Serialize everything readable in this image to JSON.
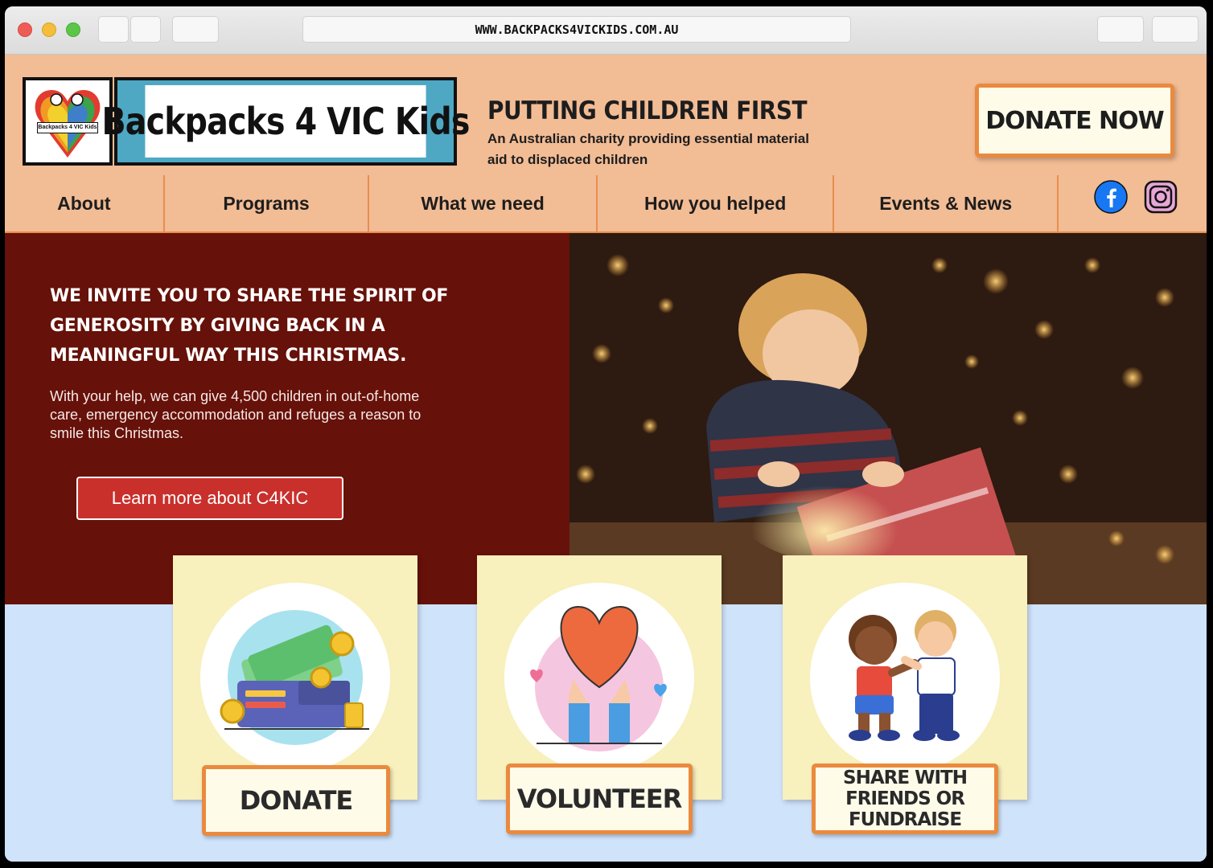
{
  "browser": {
    "url": "WWW.BACKPACKS4VICKIDS.COM.AU"
  },
  "header": {
    "logo_caption": "Backpacks 4 VIC Kids",
    "site_name": "Backpacks 4 VIC Kids",
    "tagline": "Putting Children First",
    "subtagline": "An Australian charity providing essential material aid to displaced children",
    "donate_now": "Donate Now"
  },
  "nav": {
    "items": [
      "About",
      "Programs",
      "What we need",
      "How you helped",
      "Events & News"
    ]
  },
  "social": {
    "facebook_icon": "facebook-icon",
    "instagram_icon": "instagram-icon"
  },
  "hero": {
    "heading": "We invite you to share the spirit of generosity by giving back in a meaningful way this Christmas.",
    "body": "With your help, we can give 4,500 children in out-of-home care, emergency accommodation and refuges a reason to smile this Christmas.",
    "button": "Learn more about C4KIC"
  },
  "cards": [
    {
      "label": "Donate",
      "icon": "wallet-icon"
    },
    {
      "label": "Volunteer",
      "icon": "heart-hands-icon"
    },
    {
      "label": "Share with friends or fundraise",
      "icon": "kids-friends-icon"
    }
  ],
  "colors": {
    "header_bg": "#f2bc95",
    "accent_orange": "#ea8a3f",
    "hero_maroon": "#661109",
    "button_red": "#c9302c",
    "lower_bg": "#cfe3fb",
    "card_bg": "#f8f0bd"
  }
}
